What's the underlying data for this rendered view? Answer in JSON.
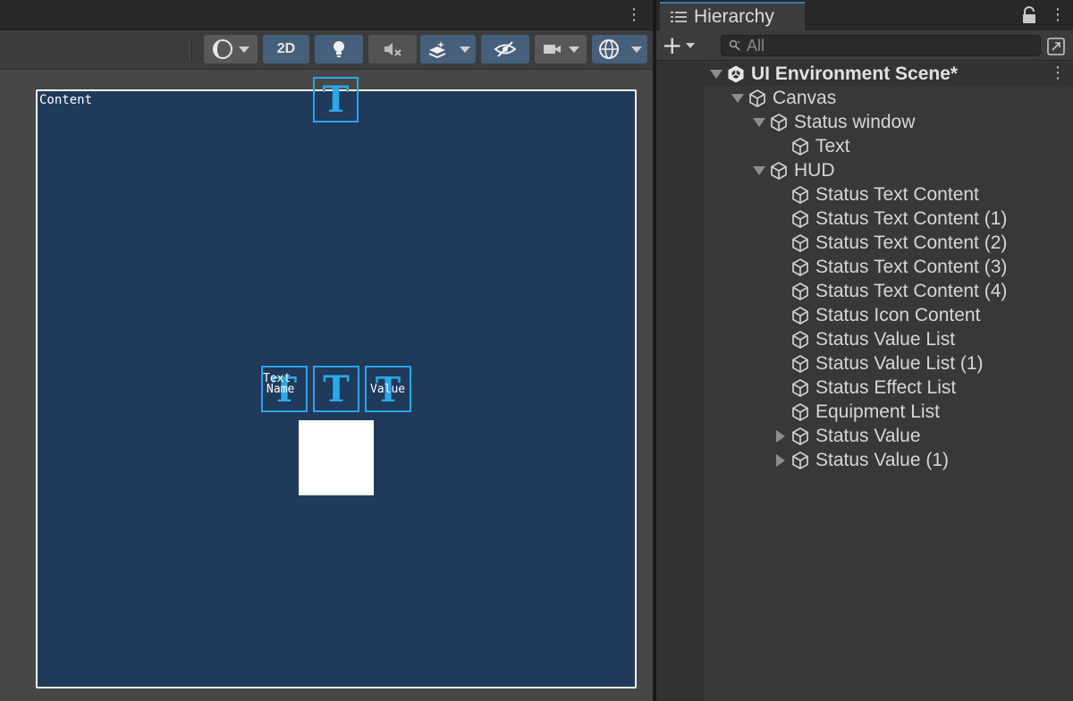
{
  "scene": {
    "toolbar": {
      "shading_icon": "sphere-shading-icon",
      "mode_2d_label": "2D",
      "lighting_icon": "lightbulb-icon",
      "audio_icon": "speaker-muted-icon",
      "effects_icon": "layers-effects-icon",
      "visibility_icon": "eye-hidden-icon",
      "camera_icon": "camera-icon",
      "gizmos_icon": "gizmo-globe-icon"
    },
    "canvas": {
      "label": "Content",
      "gizmo_glyph": "T",
      "name_label": "Name",
      "value_label": "Value",
      "text_label": "Text"
    }
  },
  "hierarchy": {
    "tab_label": "Hierarchy",
    "search_placeholder": "All",
    "items": [
      {
        "label": "UI Environment Scene*",
        "depth": 0,
        "fold": "down",
        "icon": "unity-logo-icon"
      },
      {
        "label": "Canvas",
        "depth": 1,
        "fold": "down",
        "icon": "cube-icon"
      },
      {
        "label": "Status window",
        "depth": 2,
        "fold": "down",
        "icon": "cube-icon"
      },
      {
        "label": "Text",
        "depth": 3,
        "fold": "none",
        "icon": "cube-icon"
      },
      {
        "label": "HUD",
        "depth": 2,
        "fold": "down",
        "icon": "cube-icon"
      },
      {
        "label": "Status Text Content",
        "depth": 3,
        "fold": "none",
        "icon": "cube-icon"
      },
      {
        "label": "Status Text Content (1)",
        "depth": 3,
        "fold": "none",
        "icon": "cube-icon"
      },
      {
        "label": "Status Text Content (2)",
        "depth": 3,
        "fold": "none",
        "icon": "cube-icon"
      },
      {
        "label": "Status Text Content (3)",
        "depth": 3,
        "fold": "none",
        "icon": "cube-icon"
      },
      {
        "label": "Status Text Content (4)",
        "depth": 3,
        "fold": "none",
        "icon": "cube-icon"
      },
      {
        "label": "Status Icon Content",
        "depth": 3,
        "fold": "none",
        "icon": "cube-icon"
      },
      {
        "label": "Status Value List",
        "depth": 3,
        "fold": "none",
        "icon": "cube-icon"
      },
      {
        "label": "Status Value List (1)",
        "depth": 3,
        "fold": "none",
        "icon": "cube-icon"
      },
      {
        "label": "Status Effect List",
        "depth": 3,
        "fold": "none",
        "icon": "cube-icon"
      },
      {
        "label": "Equipment List",
        "depth": 3,
        "fold": "none",
        "icon": "cube-icon"
      },
      {
        "label": "Status Value",
        "depth": 3,
        "fold": "right",
        "icon": "cube-icon"
      },
      {
        "label": "Status Value (1)",
        "depth": 3,
        "fold": "right",
        "icon": "cube-icon"
      }
    ]
  },
  "colors": {
    "canvas_fill": "#1f3a5b",
    "gizmo_blue": "#2aa6e8",
    "toolbar_active": "#46607c"
  }
}
